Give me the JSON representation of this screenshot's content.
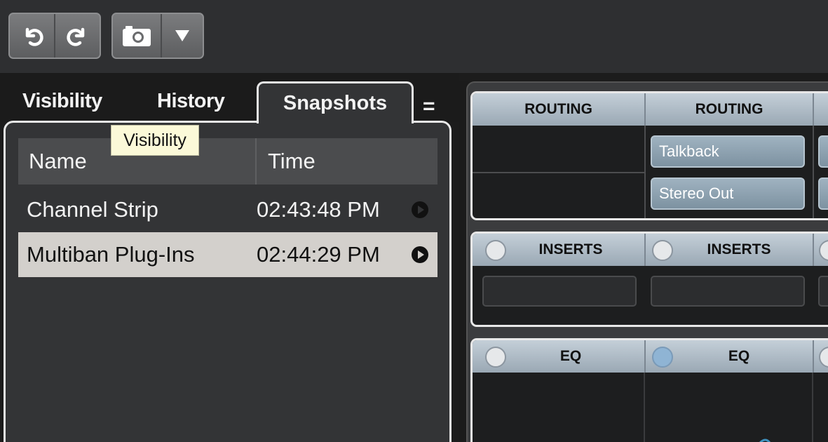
{
  "toolbar": {
    "undo_icon": "undo-icon",
    "redo_icon": "redo-icon",
    "snapshot_icon": "camera-icon",
    "dropdown_icon": "triangle-down-icon"
  },
  "tabs": {
    "visibility": "Visibility",
    "history": "History",
    "snapshots": "Snapshots",
    "menu": "="
  },
  "tooltip": "Visibility",
  "list": {
    "headers": {
      "name": "Name",
      "time": "Time"
    },
    "rows": [
      {
        "name": "Channel Strip",
        "time": "02:43:48 PM"
      },
      {
        "name": "Multiban Plug-Ins",
        "time": "02:44:29 PM"
      }
    ]
  },
  "mixer": {
    "routing": {
      "col1": "ROUTING",
      "col2": "ROUTING",
      "btn1": "Talkback",
      "btn2": "Stereo Out"
    },
    "inserts": {
      "col1": "INSERTS",
      "col2": "INSERTS"
    },
    "eq": {
      "col1": "EQ",
      "col2": "EQ"
    }
  },
  "colors": {
    "selected_row": "#d3d0cc",
    "section_header": "#b0bdc8",
    "route_button": "#8ea3b2",
    "eq_curve": "#3f93c0"
  }
}
